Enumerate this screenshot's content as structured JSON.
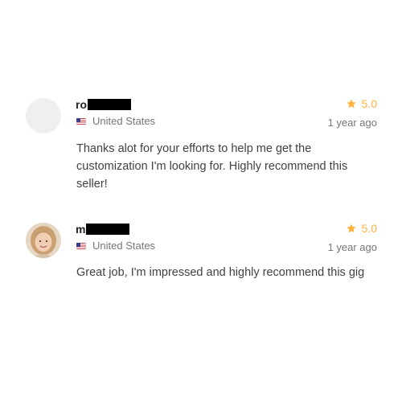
{
  "reviews": [
    {
      "username_visible": "ro",
      "country": "United States",
      "rating": "5.0",
      "time_ago": "1 year ago",
      "text": "Thanks alot for your efforts to help me get the customization I'm looking for. Highly recommend this seller!",
      "avatar": "placeholder"
    },
    {
      "username_visible": "m",
      "country": "United States",
      "rating": "5.0",
      "time_ago": "1 year ago",
      "text": "Great job, I'm impressed and highly recommend this gig",
      "avatar": "photo"
    }
  ],
  "colors": {
    "star": "#ffb33e",
    "muted_text": "#74767e",
    "body_text": "#404145",
    "redaction": "#000000"
  },
  "icons": {
    "rating": "star-icon",
    "country": "us-flag-icon"
  }
}
